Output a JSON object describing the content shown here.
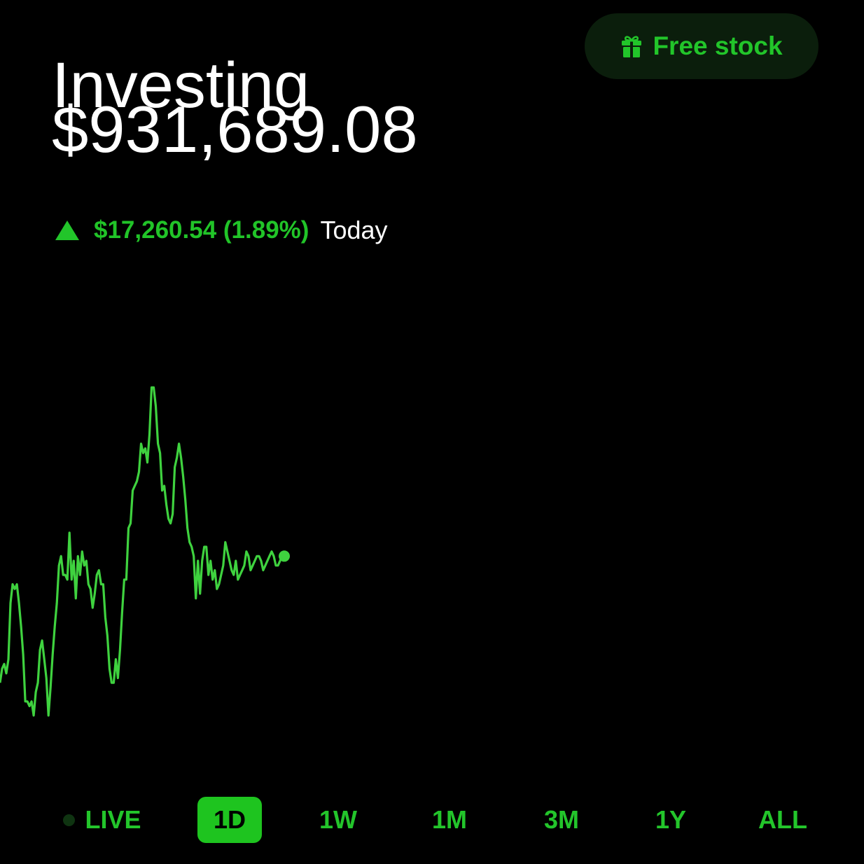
{
  "header": {
    "title": "Investing",
    "balance": "$931,689.08",
    "free_stock_label": "Free stock"
  },
  "change": {
    "direction": "up",
    "value_text": "$17,260.54 (1.89%)",
    "period": "Today"
  },
  "colors": {
    "accent_green": "#22c52a",
    "line_green": "#3fd23f",
    "background": "#000000",
    "pill_background": "#0b1e0c"
  },
  "chart_data": {
    "type": "line",
    "title": "",
    "xlabel": "",
    "ylabel": "",
    "grid": false,
    "legend": "none",
    "x": [
      0,
      1,
      2,
      3,
      4,
      5,
      6,
      7,
      8,
      9,
      10,
      11,
      12,
      13,
      14,
      15,
      16,
      17,
      18,
      19,
      20,
      21,
      22,
      23,
      24,
      25,
      26,
      27,
      28,
      29,
      30,
      31,
      32,
      33,
      34,
      35,
      36,
      37,
      38,
      39,
      40,
      41,
      42,
      43,
      44,
      45,
      46,
      47,
      48,
      49,
      50,
      51,
      52,
      53,
      54,
      55,
      56,
      57,
      58,
      59,
      60,
      61,
      62,
      63,
      64,
      65,
      66,
      67,
      68,
      69,
      70,
      71,
      72,
      73,
      74,
      75,
      76,
      77,
      78,
      79,
      80,
      81,
      82,
      83,
      84,
      85,
      86,
      87,
      88,
      89,
      90,
      91,
      92,
      93,
      94,
      95,
      96,
      97,
      98,
      99,
      100,
      101,
      102,
      103,
      104,
      105,
      106,
      107,
      108,
      109,
      110,
      111,
      112,
      113,
      114,
      115,
      116,
      117,
      118,
      119,
      120,
      121,
      122,
      123,
      124,
      125,
      126,
      127,
      128,
      129,
      130,
      131,
      132,
      133,
      134,
      135
    ],
    "values": [
      35,
      38,
      39,
      37,
      40,
      52,
      56,
      55,
      56,
      52,
      47,
      41,
      31,
      31,
      30,
      31,
      28,
      33,
      35,
      42,
      44,
      40,
      36,
      28,
      34,
      41,
      47,
      52,
      60,
      62,
      58,
      58,
      57,
      67,
      57,
      61,
      53,
      62,
      58,
      63,
      60,
      61,
      56,
      55,
      51,
      54,
      58,
      59,
      56,
      56,
      49,
      45,
      38,
      35,
      35,
      40,
      36,
      42,
      50,
      57,
      57,
      68,
      69,
      76,
      77,
      78,
      80,
      86,
      84,
      85,
      82,
      88,
      98,
      98,
      94,
      86,
      84,
      76,
      77,
      73,
      70,
      69,
      71,
      81,
      83,
      86,
      83,
      79,
      74,
      68,
      65,
      64,
      62,
      53,
      61,
      54,
      61,
      64,
      64,
      58,
      61,
      57,
      59,
      55,
      56,
      58,
      60,
      65,
      63,
      61,
      59,
      58,
      61,
      57,
      58,
      59,
      60,
      63,
      62,
      59,
      60,
      61,
      62,
      62,
      61,
      59,
      60,
      61,
      62,
      63,
      62,
      60,
      60,
      61,
      62,
      62
    ],
    "ylim": [
      25,
      100
    ]
  },
  "ranges": [
    {
      "label": "LIVE",
      "active": false
    },
    {
      "label": "1D",
      "active": true
    },
    {
      "label": "1W",
      "active": false
    },
    {
      "label": "1M",
      "active": false
    },
    {
      "label": "3M",
      "active": false
    },
    {
      "label": "1Y",
      "active": false
    },
    {
      "label": "ALL",
      "active": false
    }
  ]
}
